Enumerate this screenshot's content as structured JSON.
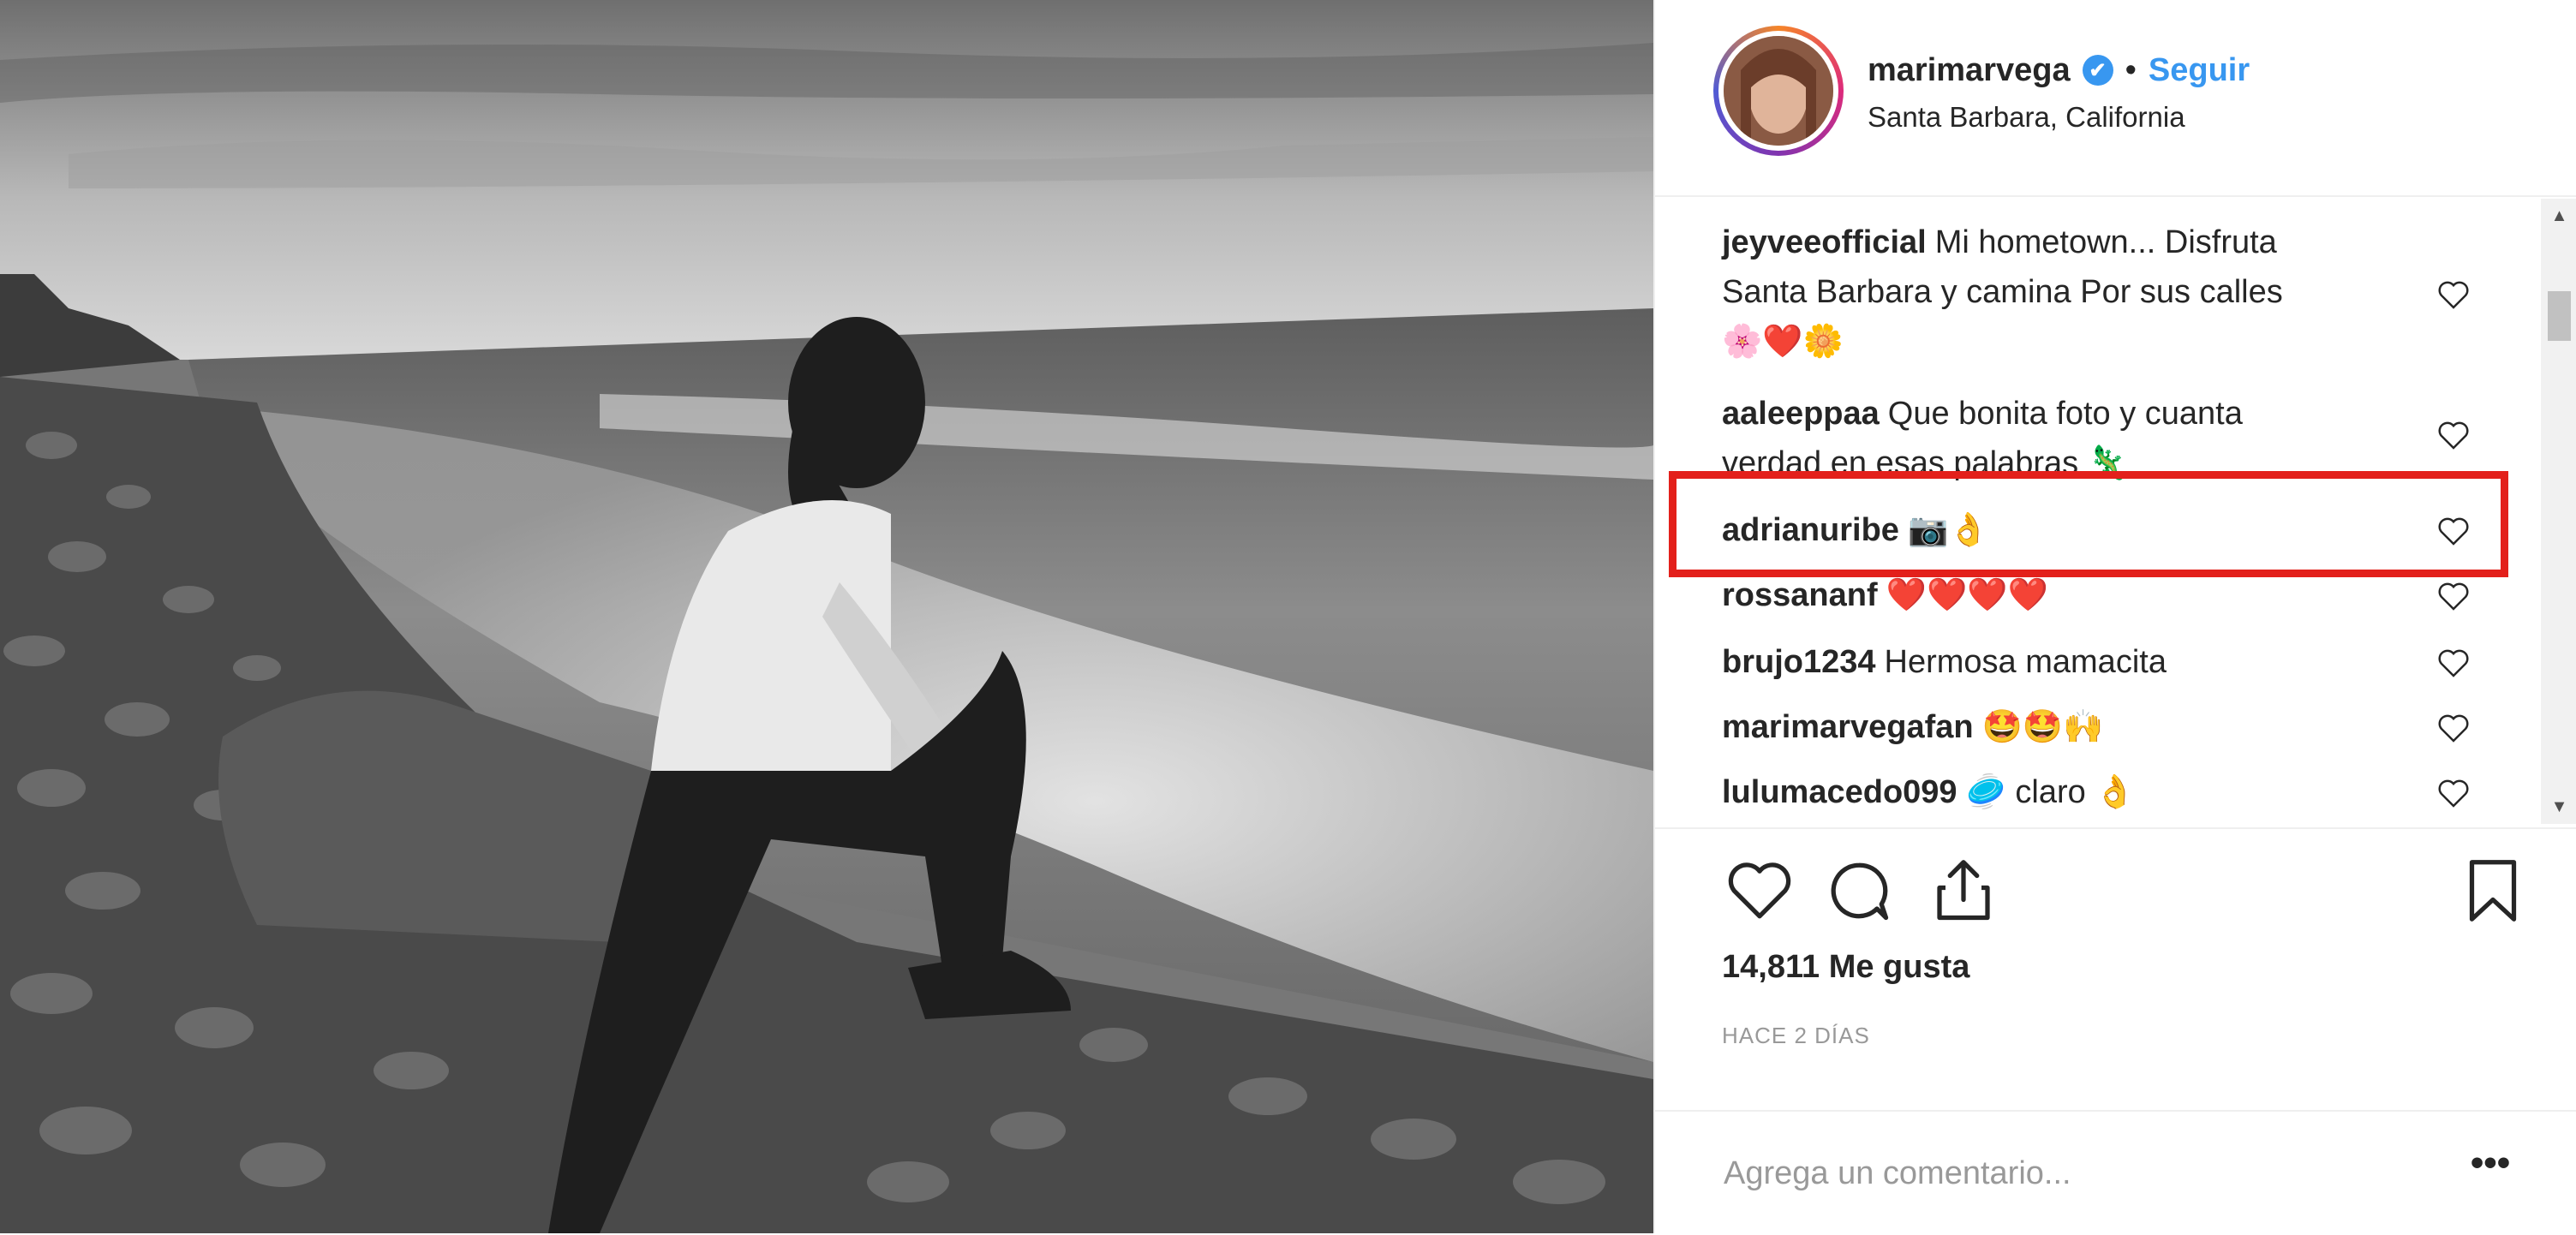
{
  "post": {
    "username": "marimarvega",
    "separator": "•",
    "follow_label": "Seguir",
    "location": "Santa Barbara, California",
    "verified_icon": "✔"
  },
  "comments": [
    {
      "author": "jeyveeofficial",
      "text": "Mi hometown... Disfruta",
      "text2": "Santa Barbara y camina Por sus calles",
      "emoji": "🌸❤️🌼"
    },
    {
      "author": "aaleeppaa",
      "text": "Que bonita foto y cuanta",
      "text2": "verdad en esas palabras 🦎"
    },
    {
      "author": "adrianuribe",
      "text": "",
      "emoji": "📷👌"
    },
    {
      "author": "rossananf",
      "text": "",
      "emoji": "❤️❤️❤️❤️"
    },
    {
      "author": "brujo1234",
      "text": "Hermosa mamacita"
    },
    {
      "author": "marimarvegafan",
      "text": "",
      "emoji": "🤩🤩🙌"
    },
    {
      "author": "lulumacedo099",
      "text": "🥏 claro 👌"
    }
  ],
  "likes_label": "14,811 Me gusta",
  "time_label": "HACE 2 DÍAS",
  "add_comment_placeholder": "Agrega un comentario...",
  "more_label": "•••",
  "scroll_up": "▲",
  "scroll_down": "▼"
}
